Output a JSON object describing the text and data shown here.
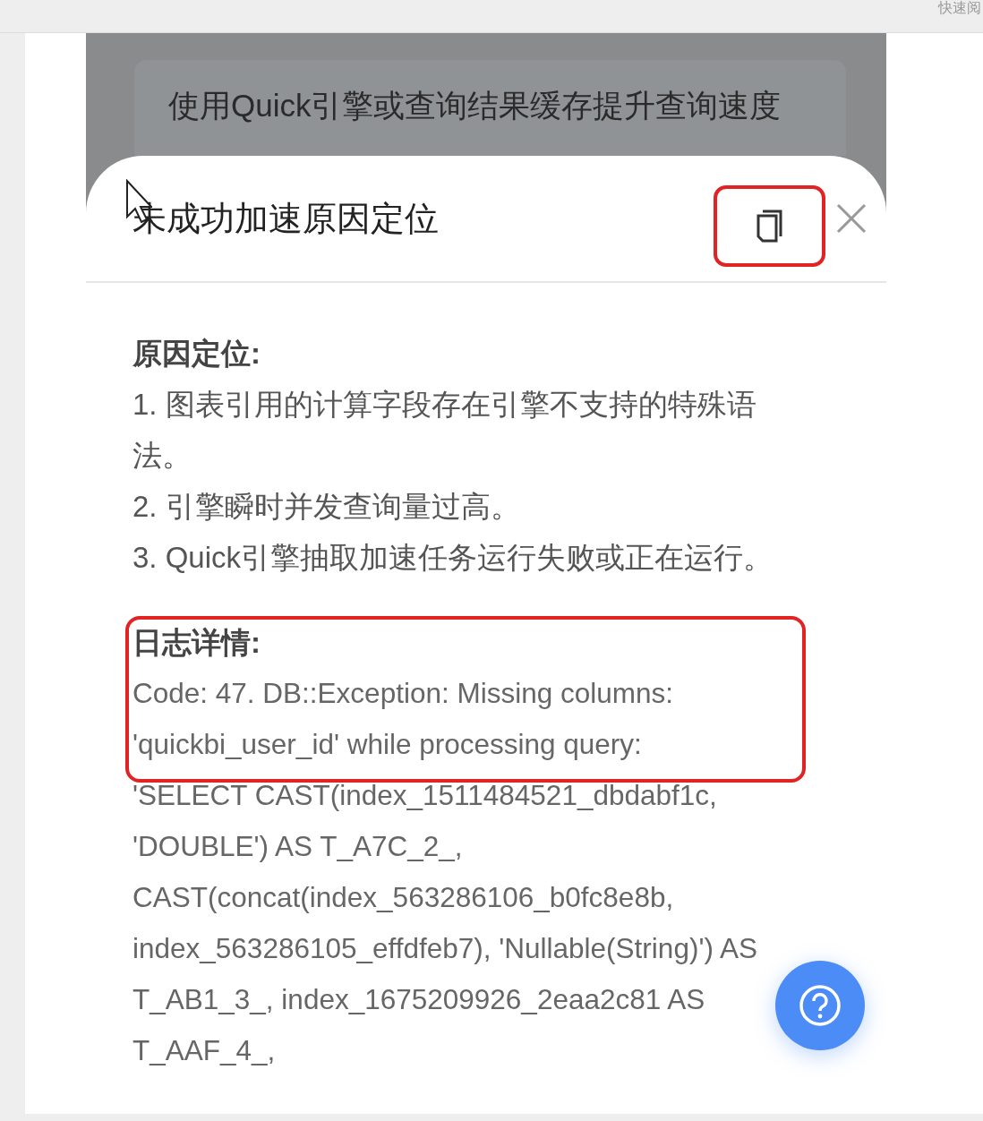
{
  "top_bar": {
    "link": "快速阅"
  },
  "background_card": {
    "title": "使用Quick引擎或查询结果缓存提升查询速度"
  },
  "sheet": {
    "title": "未成功加速原因定位",
    "copy_button": {
      "highlighted": true
    },
    "sections": [
      {
        "heading": "原因定位:",
        "kind": "list",
        "highlighted": false,
        "lines": [
          "1. 图表引用的计算字段存在引擎不支持的特殊语法。",
          "2. 引擎瞬时并发查询量过高。",
          "3. Quick引擎抽取加速任务运行失败或正在运行。"
        ]
      },
      {
        "heading": "日志详情:",
        "kind": "log",
        "highlighted": true,
        "lines": [
          "Code: 47. DB::Exception: Missing columns:",
          "'quickbi_user_id' while processing query:",
          "'SELECT CAST(index_1511484521_dbdabf1c,",
          "'DOUBLE') AS T_A7C_2_,",
          "CAST(concat(index_563286106_b0fc8e8b,",
          "index_563286105_effdfeb7), 'Nullable(String)') AS",
          "T_AB1_3_, index_1675209926_2eaa2c81 AS",
          "T_AAF_4_,"
        ]
      }
    ]
  }
}
